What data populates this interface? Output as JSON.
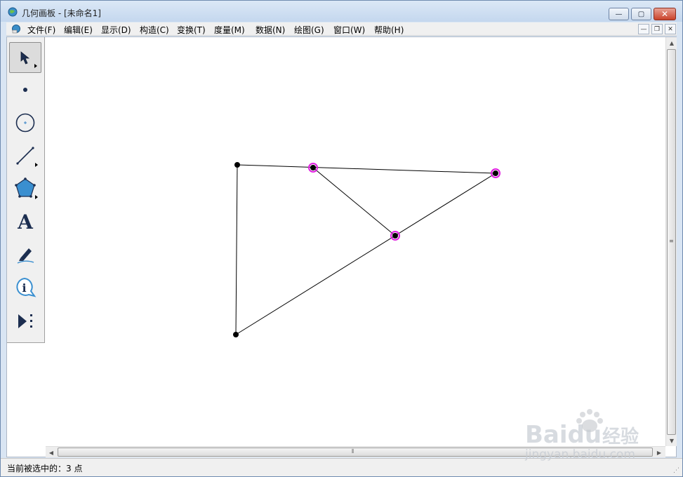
{
  "window": {
    "title": "几何画板 - [未命名1]",
    "controls": {
      "minimize": "—",
      "maximize": "▢",
      "close": "✕"
    }
  },
  "menu": {
    "items": [
      "文件(F)",
      "编辑(E)",
      "显示(D)",
      "构造(C)",
      "变换(T)",
      "度量(M)",
      "数据(N)",
      "绘图(G)",
      "窗口(W)",
      "帮助(H)"
    ],
    "mdi_controls": {
      "minimize": "—",
      "restore": "❐",
      "close": "✕"
    }
  },
  "toolbox": {
    "tools": [
      {
        "name": "arrow-select-tool",
        "icon": "arrow-icon",
        "active": true
      },
      {
        "name": "point-tool",
        "icon": "point-icon"
      },
      {
        "name": "compass-tool",
        "icon": "circle-icon"
      },
      {
        "name": "straightedge-tool",
        "icon": "segment-icon"
      },
      {
        "name": "polygon-tool",
        "icon": "pentagon-icon"
      },
      {
        "name": "text-tool",
        "icon": "text-A-icon",
        "glyph": "A"
      },
      {
        "name": "marker-tool",
        "icon": "marker-pen-icon"
      },
      {
        "name": "information-tool",
        "icon": "info-icon",
        "glyph": "i"
      },
      {
        "name": "custom-tool",
        "icon": "custom-tool-icon"
      }
    ]
  },
  "sketch": {
    "points": [
      {
        "id": "A",
        "selected": false
      },
      {
        "id": "B",
        "selected": true
      },
      {
        "id": "C",
        "selected": true
      },
      {
        "id": "D",
        "selected": true
      },
      {
        "id": "E",
        "selected": false
      }
    ],
    "segments": [
      [
        "A",
        "C"
      ],
      [
        "C",
        "E"
      ],
      [
        "E",
        "A"
      ],
      [
        "B",
        "D"
      ]
    ],
    "selection_color": "#e020e0",
    "point_color": "#000000"
  },
  "status": {
    "text": "当前被选中的：3 点"
  },
  "watermark": {
    "text": "jingyan.baidu.com",
    "brand": "Baidu",
    "brand_cn": "经验"
  }
}
